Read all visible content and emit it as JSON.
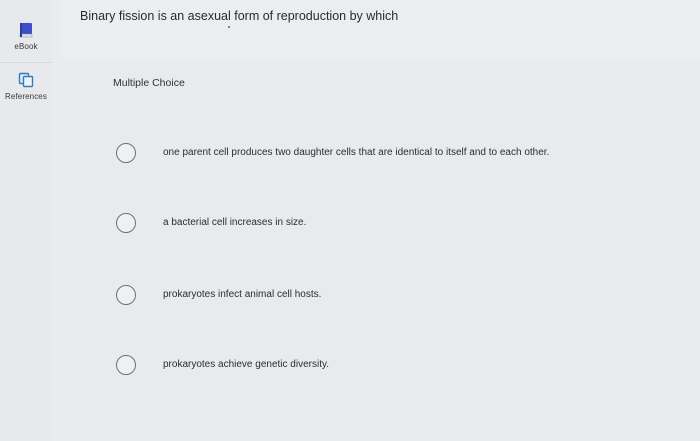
{
  "sidebar": {
    "ebook": {
      "label": "eBook",
      "icon": "book-icon",
      "color": "#3b4fc9"
    },
    "references": {
      "label": "References",
      "icon": "copy-icon",
      "color": "#2f7fb8"
    }
  },
  "question": {
    "text": "Binary fission is an asexual form of reproduction by which",
    "type_label": "Multiple Choice"
  },
  "options": [
    {
      "text": "one parent cell produces two daughter cells that are identical to itself and to each other."
    },
    {
      "text": "a bacterial cell increases in size."
    },
    {
      "text": "prokaryotes infect animal cell hosts."
    },
    {
      "text": "prokaryotes achieve genetic diversity."
    }
  ]
}
